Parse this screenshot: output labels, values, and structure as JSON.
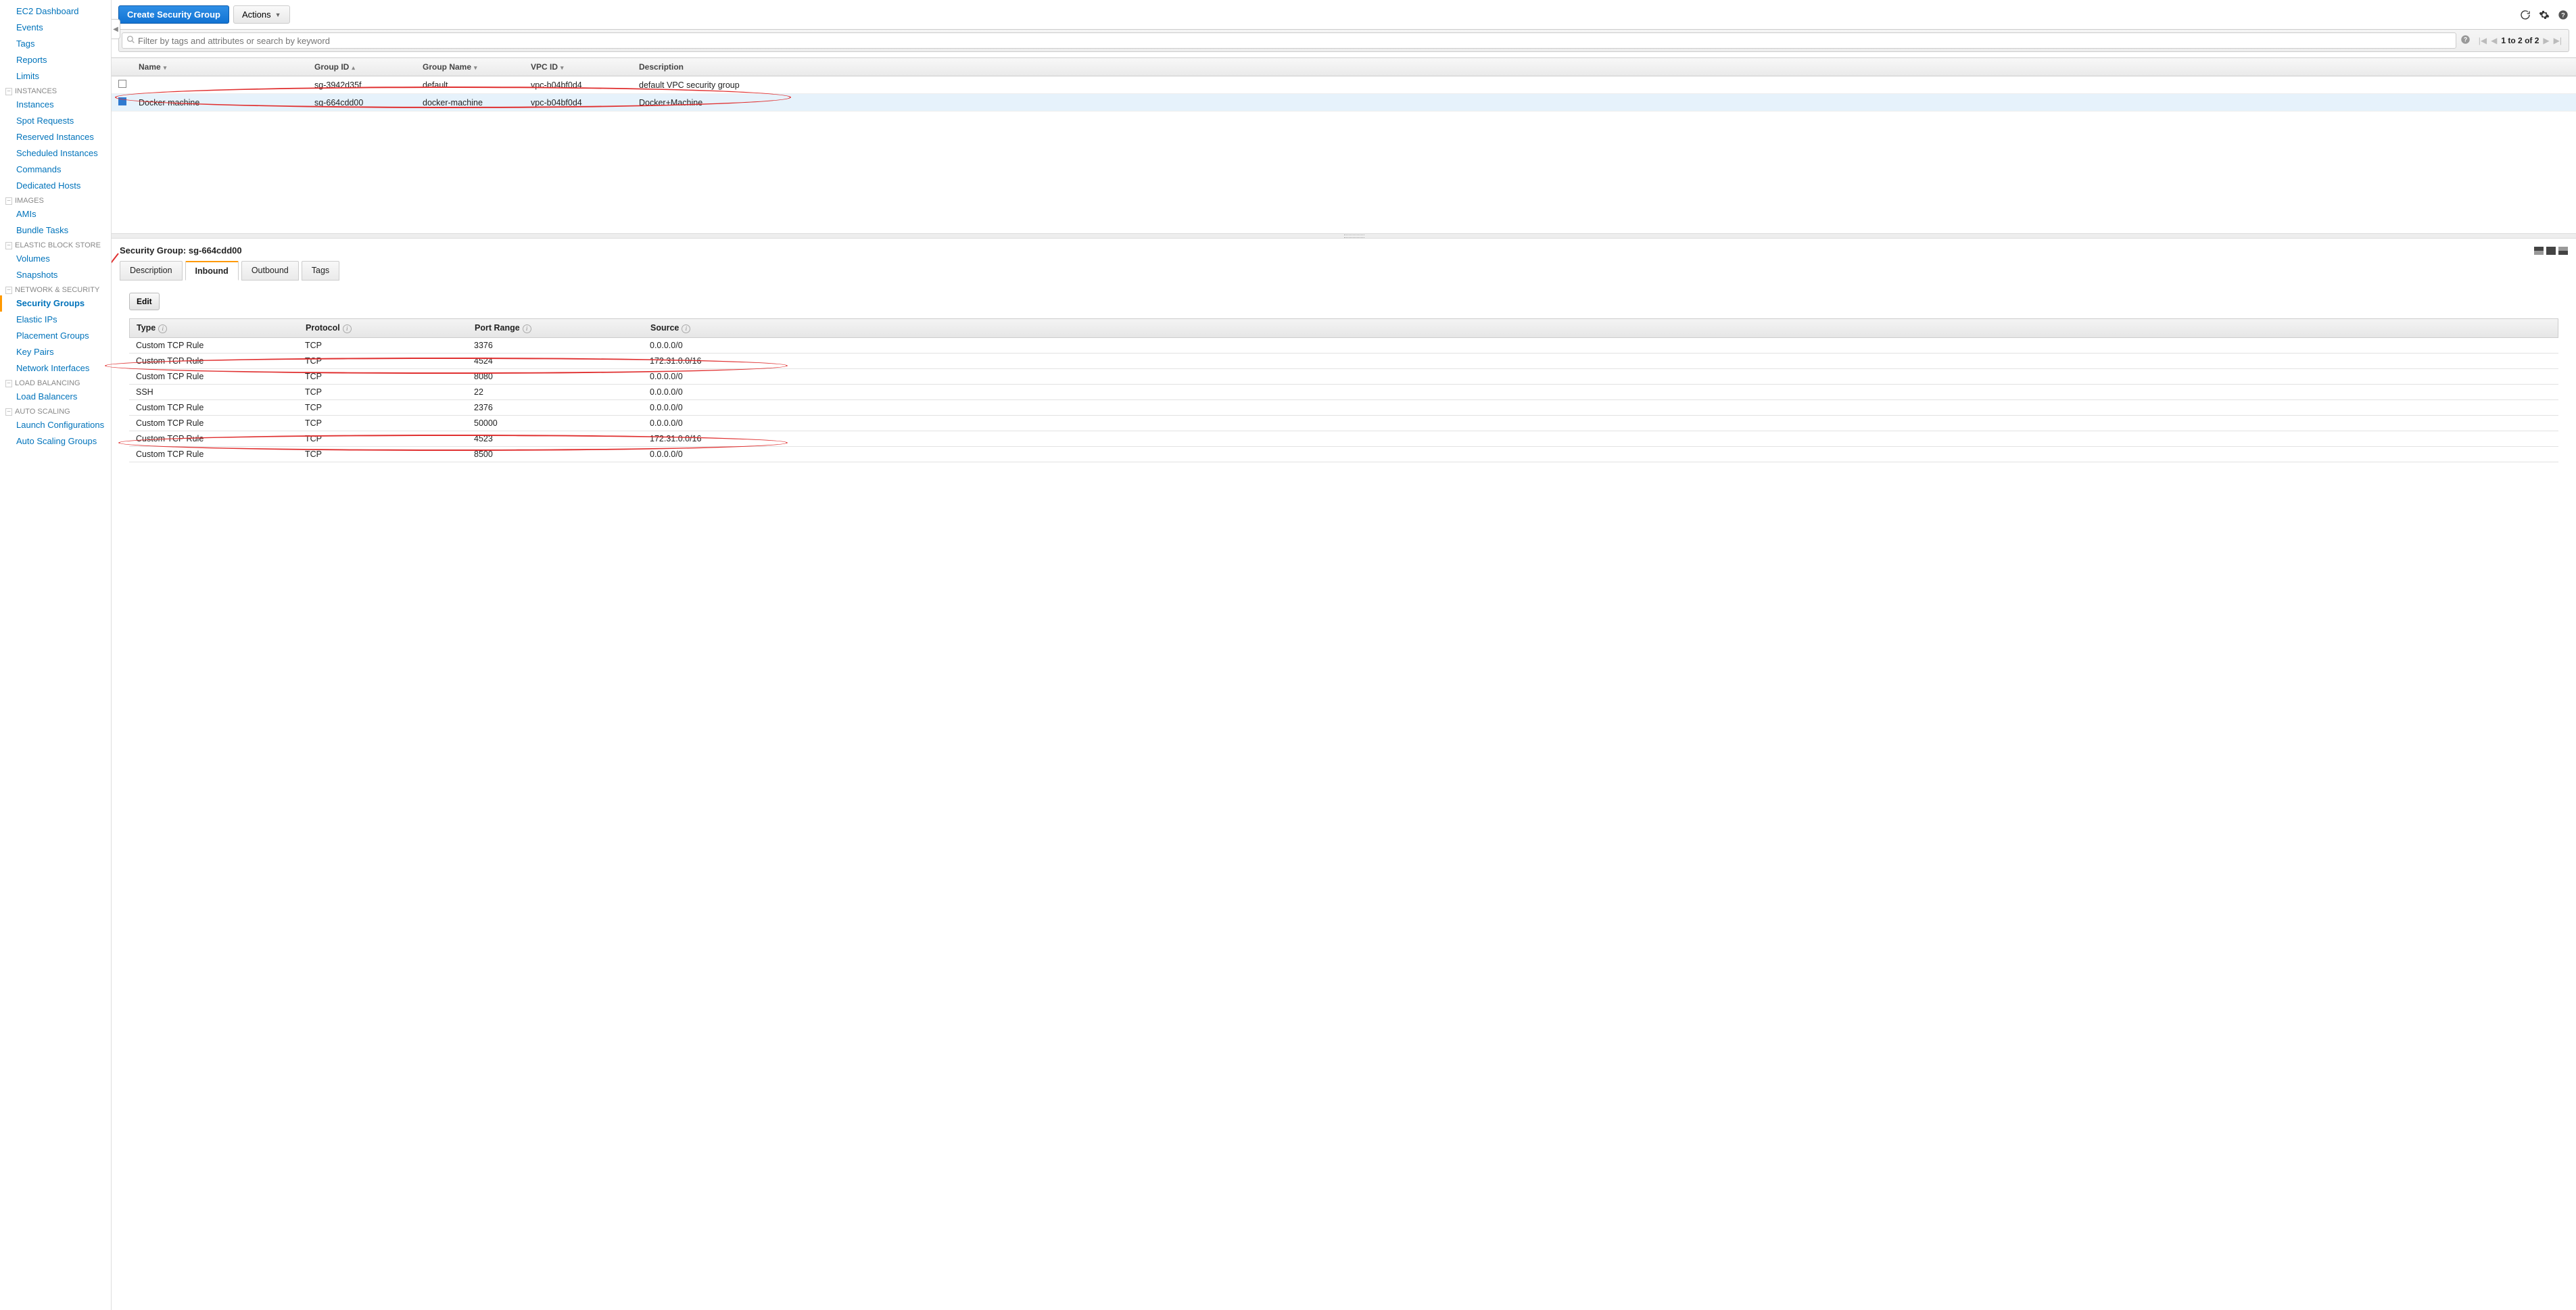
{
  "sidebar": {
    "top": [
      "EC2 Dashboard",
      "Events",
      "Tags",
      "Reports",
      "Limits"
    ],
    "sections": [
      {
        "title": "INSTANCES",
        "items": [
          "Instances",
          "Spot Requests",
          "Reserved Instances",
          "Scheduled Instances",
          "Commands",
          "Dedicated Hosts"
        ]
      },
      {
        "title": "IMAGES",
        "items": [
          "AMIs",
          "Bundle Tasks"
        ]
      },
      {
        "title": "ELASTIC BLOCK STORE",
        "items": [
          "Volumes",
          "Snapshots"
        ]
      },
      {
        "title": "NETWORK & SECURITY",
        "items": [
          "Security Groups",
          "Elastic IPs",
          "Placement Groups",
          "Key Pairs",
          "Network Interfaces"
        ]
      },
      {
        "title": "LOAD BALANCING",
        "items": [
          "Load Balancers"
        ]
      },
      {
        "title": "AUTO SCALING",
        "items": [
          "Launch Configurations",
          "Auto Scaling Groups"
        ]
      }
    ],
    "active": "Security Groups"
  },
  "toolbar": {
    "create_label": "Create Security Group",
    "actions_label": "Actions"
  },
  "search": {
    "placeholder": "Filter by tags and attributes or search by keyword"
  },
  "pager": {
    "text": "1 to 2 of 2"
  },
  "table": {
    "columns": [
      "Name",
      "Group ID",
      "Group Name",
      "VPC ID",
      "Description"
    ],
    "rows": [
      {
        "selected": false,
        "name": "",
        "group_id": "sg-3942d35f",
        "group_name": "default",
        "vpc_id": "vpc-b04bf0d4",
        "description": "default VPC security group"
      },
      {
        "selected": true,
        "name": "Docker machine",
        "group_id": "sg-664cdd00",
        "group_name": "docker-machine",
        "vpc_id": "vpc-b04bf0d4",
        "description": "Docker+Machine"
      }
    ]
  },
  "detail": {
    "title": "Security Group: sg-664cdd00",
    "tabs": [
      "Description",
      "Inbound",
      "Outbound",
      "Tags"
    ],
    "active_tab": "Inbound",
    "edit_label": "Edit",
    "rule_columns": [
      "Type",
      "Protocol",
      "Port Range",
      "Source"
    ],
    "rules": [
      {
        "type": "Custom TCP Rule",
        "protocol": "TCP",
        "port": "3376",
        "source": "0.0.0.0/0"
      },
      {
        "type": "Custom TCP Rule",
        "protocol": "TCP",
        "port": "4524",
        "source": "172.31.0.0/16"
      },
      {
        "type": "Custom TCP Rule",
        "protocol": "TCP",
        "port": "8080",
        "source": "0.0.0.0/0"
      },
      {
        "type": "SSH",
        "protocol": "TCP",
        "port": "22",
        "source": "0.0.0.0/0"
      },
      {
        "type": "Custom TCP Rule",
        "protocol": "TCP",
        "port": "2376",
        "source": "0.0.0.0/0"
      },
      {
        "type": "Custom TCP Rule",
        "protocol": "TCP",
        "port": "50000",
        "source": "0.0.0.0/0"
      },
      {
        "type": "Custom TCP Rule",
        "protocol": "TCP",
        "port": "4523",
        "source": "172.31.0.0/16"
      },
      {
        "type": "Custom TCP Rule",
        "protocol": "TCP",
        "port": "8500",
        "source": "0.0.0.0/0"
      }
    ]
  }
}
